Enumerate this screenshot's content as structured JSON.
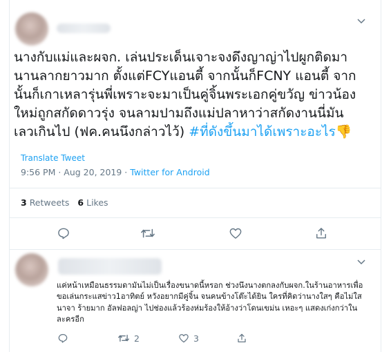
{
  "main_tweet": {
    "text_lines": [
      "นางกับแม่และผจก. เล่นประเด็นเจาะจงดึงญาญ่าไปผูกติดมา",
      "นานลากยาวมาก ตั้งแต่FCYแอนตี้ จากนั้นก็FCNY แอนตี้ จาก",
      "นั้นก็เกาเหลารุ่นพี่เพราะจะมาเป็นคู่จิ้นพระเอกคู่ขวัญ ข่าวน้อง",
      "ใหม่ถูกสกัดดาวรุ่ง  จนลามปามถึงแม่ปลาหาว่าสกัดงานนี่มัน",
      "เลวเกินไป (ฟค.คนนึงกล่าวไว้) "
    ],
    "hashtag": "#ที่ดังขึ้นมาได้เพราะอะไร",
    "emoji": "👎",
    "translate_label": "Translate Tweet",
    "timestamp": "9:56 PM · Aug 20, 2019 · ",
    "source": "Twitter for Android",
    "retweets_count": "3",
    "retweets_label": "Retweets",
    "likes_count": "6",
    "likes_label": "Likes"
  },
  "reply_tweet": {
    "text": "แค่หน้าเหมือนธรรมดามันไม่เป็นเรื่องขนาดนี้หรอก ช่วงนึงนางตกลงกับผจก.ในร้านอาหารเพื่อขอเล่นกระแสข่าว1อาทิตย์ หวังอยากมีคู่จิ้น จนคนข้างโต๊ะได้ยิน ใครที่คิดว่านางใสๆ คือไม่ใสนาจา ร้ายมาก อัลฟอลญ่า ไปช่องแล้วร้องห่มร้องให้อ้างว่าโดนเขม่น เหอะๆ แสดงเก่งกว่าในละครอีก",
    "retweets_count": "2",
    "likes_count": "3"
  },
  "icons": [
    "chevron-down-icon",
    "reply-icon",
    "retweet-icon",
    "like-icon",
    "share-icon"
  ],
  "colors": {
    "accent": "#1da1f2",
    "secondary_text": "#657786",
    "border": "#e6ecf0"
  }
}
